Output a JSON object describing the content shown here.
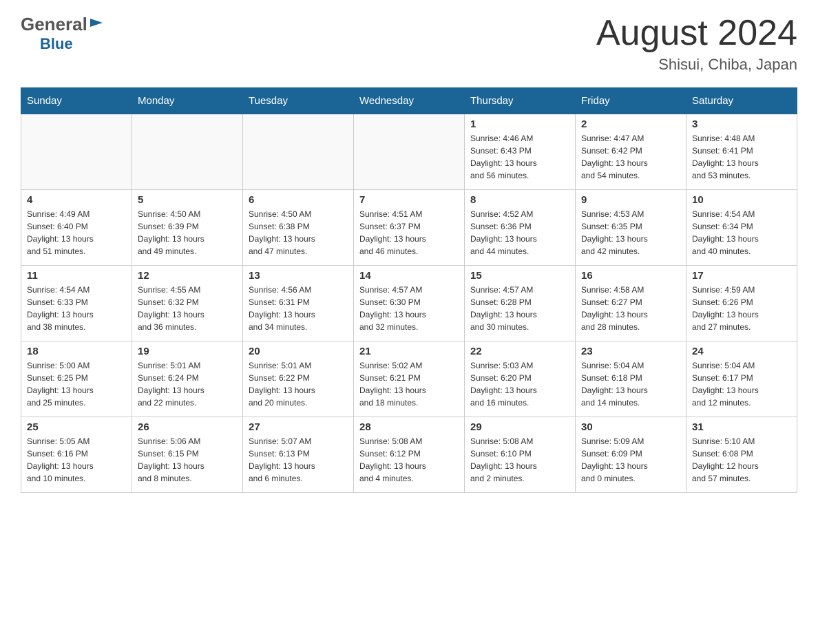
{
  "header": {
    "logo_general": "General",
    "logo_blue": "Blue",
    "month_title": "August 2024",
    "location": "Shisui, Chiba, Japan"
  },
  "weekdays": [
    "Sunday",
    "Monday",
    "Tuesday",
    "Wednesday",
    "Thursday",
    "Friday",
    "Saturday"
  ],
  "weeks": [
    [
      {
        "day": "",
        "info": ""
      },
      {
        "day": "",
        "info": ""
      },
      {
        "day": "",
        "info": ""
      },
      {
        "day": "",
        "info": ""
      },
      {
        "day": "1",
        "info": "Sunrise: 4:46 AM\nSunset: 6:43 PM\nDaylight: 13 hours\nand 56 minutes."
      },
      {
        "day": "2",
        "info": "Sunrise: 4:47 AM\nSunset: 6:42 PM\nDaylight: 13 hours\nand 54 minutes."
      },
      {
        "day": "3",
        "info": "Sunrise: 4:48 AM\nSunset: 6:41 PM\nDaylight: 13 hours\nand 53 minutes."
      }
    ],
    [
      {
        "day": "4",
        "info": "Sunrise: 4:49 AM\nSunset: 6:40 PM\nDaylight: 13 hours\nand 51 minutes."
      },
      {
        "day": "5",
        "info": "Sunrise: 4:50 AM\nSunset: 6:39 PM\nDaylight: 13 hours\nand 49 minutes."
      },
      {
        "day": "6",
        "info": "Sunrise: 4:50 AM\nSunset: 6:38 PM\nDaylight: 13 hours\nand 47 minutes."
      },
      {
        "day": "7",
        "info": "Sunrise: 4:51 AM\nSunset: 6:37 PM\nDaylight: 13 hours\nand 46 minutes."
      },
      {
        "day": "8",
        "info": "Sunrise: 4:52 AM\nSunset: 6:36 PM\nDaylight: 13 hours\nand 44 minutes."
      },
      {
        "day": "9",
        "info": "Sunrise: 4:53 AM\nSunset: 6:35 PM\nDaylight: 13 hours\nand 42 minutes."
      },
      {
        "day": "10",
        "info": "Sunrise: 4:54 AM\nSunset: 6:34 PM\nDaylight: 13 hours\nand 40 minutes."
      }
    ],
    [
      {
        "day": "11",
        "info": "Sunrise: 4:54 AM\nSunset: 6:33 PM\nDaylight: 13 hours\nand 38 minutes."
      },
      {
        "day": "12",
        "info": "Sunrise: 4:55 AM\nSunset: 6:32 PM\nDaylight: 13 hours\nand 36 minutes."
      },
      {
        "day": "13",
        "info": "Sunrise: 4:56 AM\nSunset: 6:31 PM\nDaylight: 13 hours\nand 34 minutes."
      },
      {
        "day": "14",
        "info": "Sunrise: 4:57 AM\nSunset: 6:30 PM\nDaylight: 13 hours\nand 32 minutes."
      },
      {
        "day": "15",
        "info": "Sunrise: 4:57 AM\nSunset: 6:28 PM\nDaylight: 13 hours\nand 30 minutes."
      },
      {
        "day": "16",
        "info": "Sunrise: 4:58 AM\nSunset: 6:27 PM\nDaylight: 13 hours\nand 28 minutes."
      },
      {
        "day": "17",
        "info": "Sunrise: 4:59 AM\nSunset: 6:26 PM\nDaylight: 13 hours\nand 27 minutes."
      }
    ],
    [
      {
        "day": "18",
        "info": "Sunrise: 5:00 AM\nSunset: 6:25 PM\nDaylight: 13 hours\nand 25 minutes."
      },
      {
        "day": "19",
        "info": "Sunrise: 5:01 AM\nSunset: 6:24 PM\nDaylight: 13 hours\nand 22 minutes."
      },
      {
        "day": "20",
        "info": "Sunrise: 5:01 AM\nSunset: 6:22 PM\nDaylight: 13 hours\nand 20 minutes."
      },
      {
        "day": "21",
        "info": "Sunrise: 5:02 AM\nSunset: 6:21 PM\nDaylight: 13 hours\nand 18 minutes."
      },
      {
        "day": "22",
        "info": "Sunrise: 5:03 AM\nSunset: 6:20 PM\nDaylight: 13 hours\nand 16 minutes."
      },
      {
        "day": "23",
        "info": "Sunrise: 5:04 AM\nSunset: 6:18 PM\nDaylight: 13 hours\nand 14 minutes."
      },
      {
        "day": "24",
        "info": "Sunrise: 5:04 AM\nSunset: 6:17 PM\nDaylight: 13 hours\nand 12 minutes."
      }
    ],
    [
      {
        "day": "25",
        "info": "Sunrise: 5:05 AM\nSunset: 6:16 PM\nDaylight: 13 hours\nand 10 minutes."
      },
      {
        "day": "26",
        "info": "Sunrise: 5:06 AM\nSunset: 6:15 PM\nDaylight: 13 hours\nand 8 minutes."
      },
      {
        "day": "27",
        "info": "Sunrise: 5:07 AM\nSunset: 6:13 PM\nDaylight: 13 hours\nand 6 minutes."
      },
      {
        "day": "28",
        "info": "Sunrise: 5:08 AM\nSunset: 6:12 PM\nDaylight: 13 hours\nand 4 minutes."
      },
      {
        "day": "29",
        "info": "Sunrise: 5:08 AM\nSunset: 6:10 PM\nDaylight: 13 hours\nand 2 minutes."
      },
      {
        "day": "30",
        "info": "Sunrise: 5:09 AM\nSunset: 6:09 PM\nDaylight: 13 hours\nand 0 minutes."
      },
      {
        "day": "31",
        "info": "Sunrise: 5:10 AM\nSunset: 6:08 PM\nDaylight: 12 hours\nand 57 minutes."
      }
    ]
  ]
}
